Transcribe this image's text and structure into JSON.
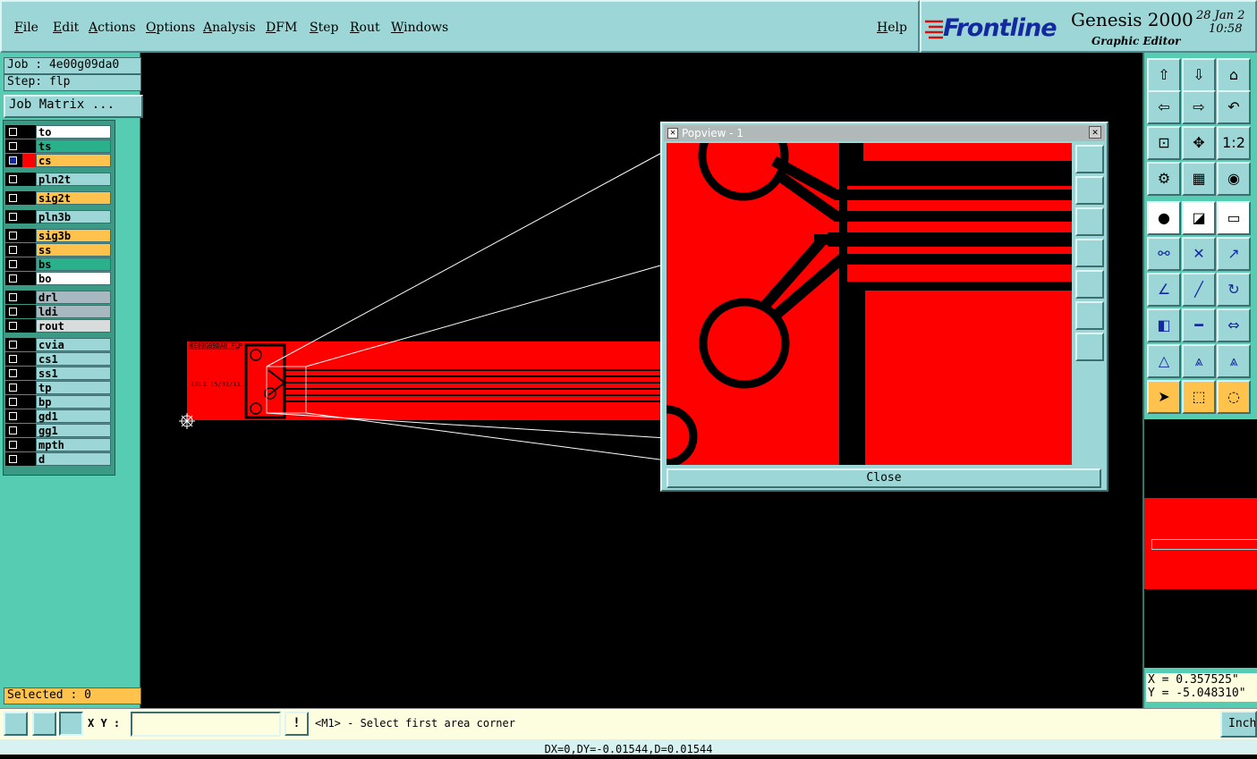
{
  "menubar": {
    "items": [
      "File",
      "Edit",
      "Actions",
      "Options",
      "Analysis",
      "DFM",
      "Step",
      "Rout",
      "Windows"
    ],
    "help": "Help"
  },
  "brand": {
    "logo": "Frontline",
    "product": "Genesis 2000",
    "subtitle": "Graphic Editor",
    "date": "28 Jan 2",
    "time": "10:58"
  },
  "job": {
    "job_label": "Job : 4e00g09da0",
    "step_label": "Step: flp",
    "matrix_button": "Job Matrix ..."
  },
  "layers": [
    {
      "name": "to",
      "color": "#ffffff"
    },
    {
      "name": "ts",
      "color": "#2ab08a"
    },
    {
      "name": "cs",
      "color": "#ffc34d",
      "selected": true
    },
    {
      "name": "pln2t",
      "color": "#9dd6d6"
    },
    {
      "name": "sig2t",
      "color": "#ffc34d"
    },
    {
      "name": "pln3b",
      "color": "#9dd6d6"
    },
    {
      "name": "sig3b",
      "color": "#ffc34d"
    },
    {
      "name": "ss",
      "color": "#ffc34d"
    },
    {
      "name": "bs",
      "color": "#2ab08a"
    },
    {
      "name": "bo",
      "color": "#ffffff"
    },
    {
      "name": "drl",
      "color": "#a8b8c0"
    },
    {
      "name": "ldi",
      "color": "#a8b8c0"
    },
    {
      "name": "rout",
      "color": "#d8dcdc"
    },
    {
      "name": "cvia",
      "color": "#9dd6d6"
    },
    {
      "name": "cs1",
      "color": "#9dd6d6"
    },
    {
      "name": "ss1",
      "color": "#9dd6d6"
    },
    {
      "name": "tp",
      "color": "#9dd6d6"
    },
    {
      "name": "bp",
      "color": "#9dd6d6"
    },
    {
      "name": "gd1",
      "color": "#9dd6d6"
    },
    {
      "name": "gg1",
      "color": "#9dd6d6"
    },
    {
      "name": "mpth",
      "color": "#9dd6d6"
    },
    {
      "name": "d",
      "color": "#9dd6d6"
    }
  ],
  "selected_label": "Selected : 0",
  "board": {
    "label1": "4E00G09DA0 FLP",
    "label2": "CBL1 15/31/11.4"
  },
  "popview": {
    "title": "Popview - 1",
    "close_label": "Close"
  },
  "coords": {
    "x": "X = 0.357525\"",
    "y": "Y = -5.048310\""
  },
  "bottom": {
    "xy_label": "X Y :",
    "xy_value": "",
    "message": "<M1> - Select first area corner",
    "units": "Inch"
  },
  "statusline": "DX=0,DY=-0.01544,D=0.01544",
  "colors": {
    "copper": "#ff0000",
    "panel": "#56cdb3",
    "widget": "#9dd6d6",
    "highlight": "#ffc34d"
  }
}
